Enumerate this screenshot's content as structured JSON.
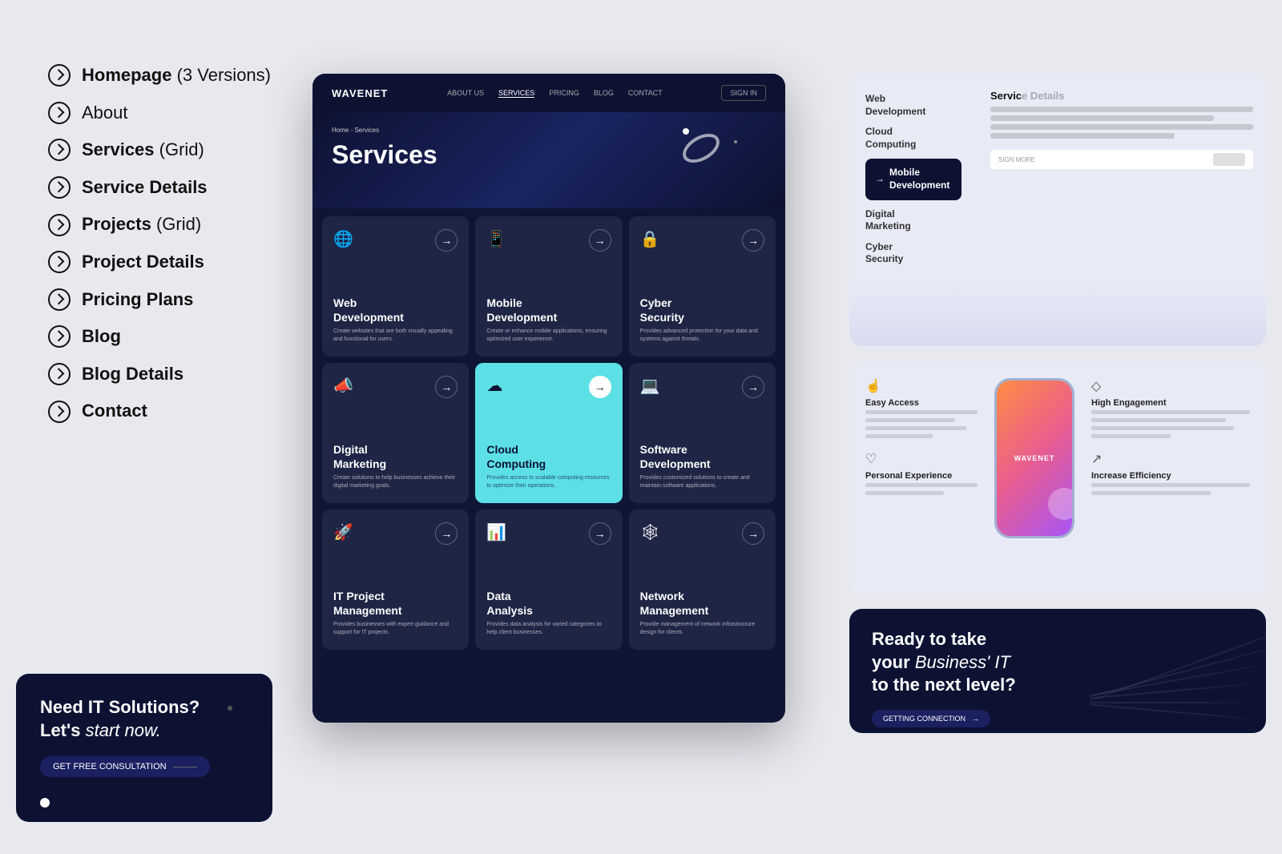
{
  "nav": {
    "items": [
      {
        "id": "homepage",
        "label": "Homepage",
        "sublabel": "(3 Versions)"
      },
      {
        "id": "about",
        "label": "About",
        "sublabel": ""
      },
      {
        "id": "services",
        "label": "Services",
        "sublabel": "(Grid)",
        "bold": true
      },
      {
        "id": "service-details",
        "label": "Service Details",
        "sublabel": ""
      },
      {
        "id": "projects",
        "label": "Projects",
        "sublabel": "(Grid)"
      },
      {
        "id": "project-details",
        "label": "Project Details",
        "sublabel": ""
      },
      {
        "id": "pricing",
        "label": "Pricing Plans",
        "sublabel": ""
      },
      {
        "id": "blog",
        "label": "Blog",
        "sublabel": ""
      },
      {
        "id": "blog-details",
        "label": "Blog Details",
        "sublabel": ""
      },
      {
        "id": "contact",
        "label": "Contact",
        "sublabel": ""
      }
    ]
  },
  "cta_card": {
    "line1": "Need IT Solutions?",
    "line2": "Let's",
    "italic": "start now.",
    "btn_label": "GET FREE CONSULTATION"
  },
  "mockup": {
    "logo": "WAVENET",
    "nav_items": [
      "ABOUT US",
      "SERVICES",
      "PRICING",
      "BLOG",
      "CONTACT"
    ],
    "signin": "SIGN IN",
    "breadcrumb_home": "Home",
    "breadcrumb_page": "Services",
    "page_title": "Services",
    "services": [
      {
        "id": "web-dev",
        "icon": "🌐",
        "name": "Web\nDevelopment",
        "desc": "Create websites that are both visually appealing and functional for users.",
        "highlight": false
      },
      {
        "id": "mobile-dev",
        "icon": "📱",
        "name": "Mobile\nDevelopment",
        "desc": "Create or enhance mobile applications, ensuring optimized user experience.",
        "highlight": false
      },
      {
        "id": "cyber-sec",
        "icon": "🔒",
        "name": "Cyber\nSecurity",
        "desc": "Provides advanced protection for your data and systems against threats.",
        "highlight": false
      },
      {
        "id": "digital-marketing",
        "icon": "📣",
        "name": "Digital\nMarketing",
        "desc": "Create solutions to help businesses achieve their digital marketing goals.",
        "highlight": false
      },
      {
        "id": "cloud-computing",
        "icon": "☁",
        "name": "Cloud\nComputing",
        "desc": "Provides access to scalable computing resources to optimize their operations.",
        "highlight": true
      },
      {
        "id": "software-dev",
        "icon": "💻",
        "name": "Software\nDevelopment",
        "desc": "Provides customized solutions to create and maintain software applications.",
        "highlight": false
      },
      {
        "id": "it-project",
        "icon": "🚀",
        "name": "IT Project\nManagement",
        "desc": "Provides businesses with expert guidance and support for IT projects.",
        "highlight": false
      },
      {
        "id": "data-analysis",
        "icon": "📊",
        "name": "Data\nAnalysis",
        "desc": "Provides data analysis for varied categories to help client businesses.",
        "highlight": false
      },
      {
        "id": "network-mgmt",
        "icon": "🕸",
        "name": "Network\nManagement",
        "desc": "Provide management of network infrastructure design for clients.",
        "highlight": false
      }
    ]
  },
  "right_panel": {
    "service_list": [
      {
        "id": "web-dev",
        "label": "Web\nDevelopment",
        "active": false
      },
      {
        "id": "cloud",
        "label": "Cloud\nComputing",
        "active": false
      },
      {
        "id": "mobile",
        "label": "Mobile\nDevelopment",
        "active": true
      },
      {
        "id": "digital",
        "label": "Digital\nMarketing",
        "active": false
      },
      {
        "id": "cyber",
        "label": "Cyber\nSecurity",
        "active": false
      }
    ],
    "service_page_label": "Servic",
    "features": [
      {
        "icon": "☝",
        "label": "Easy Access",
        "id": "easy-access"
      },
      {
        "icon": "♡",
        "label": "Personal Experience",
        "id": "personal-exp"
      }
    ],
    "features_right": [
      {
        "icon": "⬡",
        "label": "High Engagement",
        "id": "high-engagement"
      },
      {
        "icon": "↗",
        "label": "Increase Efficienc",
        "id": "increase-eff"
      }
    ],
    "phone_brand": "WAVENET",
    "cta": {
      "line1": "Ready to take",
      "line2_prefix": "your",
      "line2_italic": "Business' IT",
      "line3": "to the next level?",
      "btn_label": "GETTING CONNECTION"
    }
  }
}
